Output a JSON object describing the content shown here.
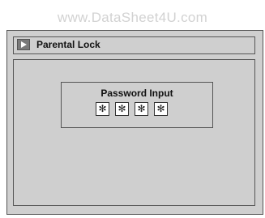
{
  "watermark": "www.DataSheet4U.com",
  "header": {
    "icon": "play-icon",
    "title": "Parental Lock"
  },
  "password_dialog": {
    "title": "Password Input",
    "digits": [
      "✻",
      "✻",
      "✻",
      "✻"
    ]
  }
}
